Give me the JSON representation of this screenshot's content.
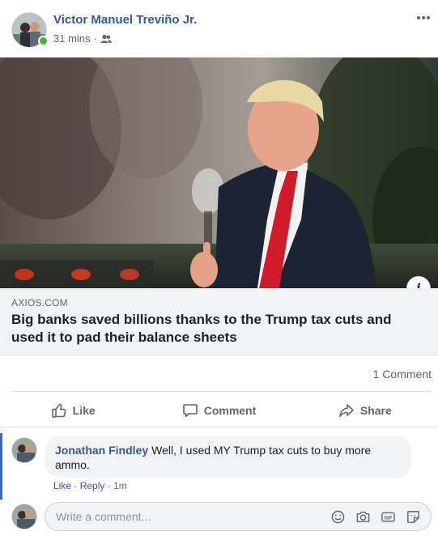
{
  "post": {
    "author": "Victor Manuel Treviño Jr.",
    "time": "31 mins",
    "separator": "·",
    "audience_icon": "friends-icon",
    "more_icon": "more-options-icon"
  },
  "link": {
    "image_icon": "article-photo",
    "info_icon": "info-icon",
    "info_label": "i",
    "domain": "AXIOS.COM",
    "title": "Big banks saved billions thanks to the Trump tax cuts and used it to pad their balance sheets"
  },
  "stats": {
    "comment_count": "1 Comment"
  },
  "actions": [
    {
      "label": "Like",
      "icon": "thumbs-up-icon"
    },
    {
      "label": "Comment",
      "icon": "speech-bubble-icon"
    },
    {
      "label": "Share",
      "icon": "share-arrow-icon"
    }
  ],
  "comment": {
    "name": "Jonathan Findley",
    "text": "Well, I used MY Trump tax cuts to buy more ammo.",
    "like": "Like",
    "reply": "Reply",
    "sep": "·",
    "time": "1m"
  },
  "composer": {
    "placeholder": "Write a comment...",
    "icons": [
      "emoji-icon",
      "camera-icon",
      "gif-icon",
      "sticker-icon"
    ]
  },
  "colors": {
    "link_blue": "#385898",
    "accent": "#4267b2",
    "online": "#42b72a",
    "muted": "#606770",
    "card_bg": "#f2f3f5"
  }
}
